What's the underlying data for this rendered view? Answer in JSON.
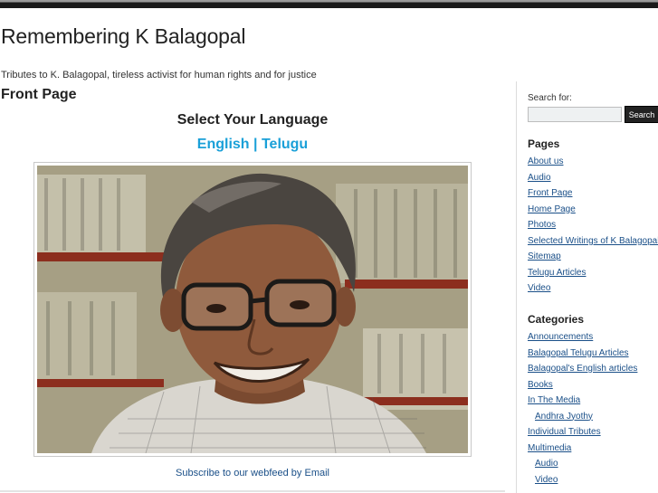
{
  "site": {
    "title": "Remembering K Balagopal",
    "tagline": "Tributes to K. Balagopal, tireless activist for human rights and for justice"
  },
  "main": {
    "page_heading": "Front Page",
    "language_heading": "Select Your Language",
    "language_links": [
      {
        "label": "English"
      },
      {
        "label": "Telugu"
      }
    ],
    "language_separator": " | ",
    "subscribe": {
      "text_before": "Subscribe to our ",
      "webfeed": "webfeed",
      "text_middle": " by ",
      "email": "Email"
    }
  },
  "sidebar": {
    "search_label": "Search for:",
    "search_value": "",
    "search_button": "Search",
    "pages_title": "Pages",
    "pages": [
      {
        "label": "About us"
      },
      {
        "label": "Audio"
      },
      {
        "label": "Front Page"
      },
      {
        "label": "Home Page"
      },
      {
        "label": "Photos"
      },
      {
        "label": "Selected Writings of K Balagopal"
      },
      {
        "label": "Sitemap"
      },
      {
        "label": "Telugu Articles"
      },
      {
        "label": "Video"
      }
    ],
    "categories_title": "Categories",
    "categories": [
      {
        "label": "Announcements"
      },
      {
        "label": "Balagopal Telugu Articles"
      },
      {
        "label": "Balagopal's English articles"
      },
      {
        "label": "Books"
      },
      {
        "label": "In The Media"
      },
      {
        "label": "Andhra Jyothy"
      },
      {
        "label": "Individual Tributes"
      },
      {
        "label": "Multimedia"
      },
      {
        "label": "Audio"
      },
      {
        "label": "Video"
      }
    ]
  },
  "colors": {
    "link": "#1a4f88",
    "language_link": "#1aa0d8",
    "search_button": "#222222"
  }
}
